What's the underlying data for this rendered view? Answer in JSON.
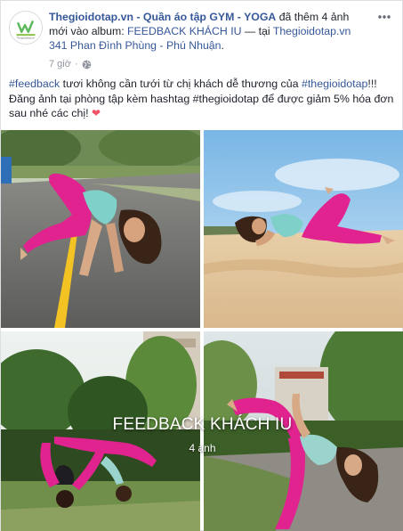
{
  "header": {
    "page_name": "Thegioidotap.vn - Quần áo tập GYM - YOGA",
    "action_text": " đã thêm 4 ảnh mới vào album: ",
    "album_link": "FEEDBACK KHÁCH IU",
    "location_prefix": " — tại ",
    "location_link": "Thegioidotap.vn 341 Phan Đình Phùng - Phú Nhuận",
    "end_punct": ".",
    "time": "7 giờ",
    "privacy_icon": "globe-icon",
    "more_icon": "more-options-icon",
    "avatar_text": "Thegioidotap.vn"
  },
  "post": {
    "hashtag1": "#feedback",
    "text1": " tươi không cần tưới từ chị khách dễ thương của ",
    "hashtag2": "#thegioidotap",
    "text2": "!!! Đăng ảnh tại phòng tập kèm hashtag #thegioidotap để được giảm 5% hóa đơn sau nhé các chị! ",
    "heart": "❤"
  },
  "album": {
    "title": "FEEDBACK KHÁCH IU",
    "count": "4 ảnh"
  },
  "colors": {
    "link": "#365899",
    "meta": "#90949c",
    "outfit_pink": "#e0238f",
    "outfit_teal": "#7fd0c8"
  }
}
